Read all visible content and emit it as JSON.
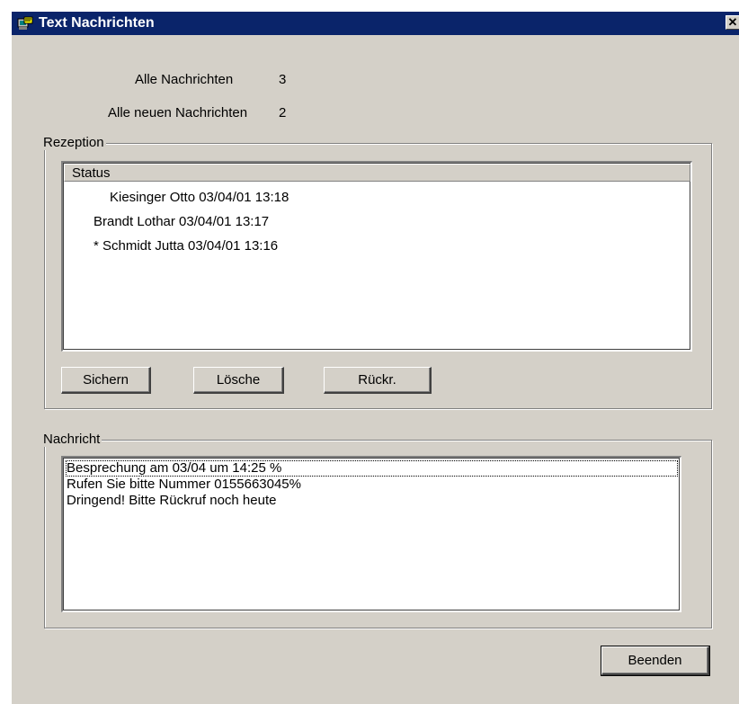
{
  "window": {
    "title": "Text Nachrichten",
    "close_label": "✕"
  },
  "summary": {
    "all_label": "Alle Nachrichten",
    "all_count": "3",
    "new_label": "Alle neuen Nachrichten",
    "new_count": "2"
  },
  "reception": {
    "group_label": "Rezeption",
    "column_header": "Status",
    "items": [
      "Kiesinger Otto 03/04/01 13:18",
      "Brandt Lothar 03/04/01 13:17",
      "* Schmidt Jutta 03/04/01 13:16"
    ],
    "buttons": {
      "save": "Sichern",
      "delete": "Lösche",
      "callback": "Rückr."
    }
  },
  "message": {
    "group_label": "Nachricht",
    "lines": [
      "Besprechung am 03/04 um 14:25 %",
      "Rufen Sie bitte Nummer 0155663045%",
      "Dringend! Bitte Rückruf noch heute"
    ]
  },
  "footer": {
    "close_button": "Beenden"
  },
  "colors": {
    "titlebar": "#0a246a",
    "face": "#d4d0c8"
  },
  "icons": {
    "title_icon": "messages-app-icon",
    "close_icon": "close-icon"
  }
}
